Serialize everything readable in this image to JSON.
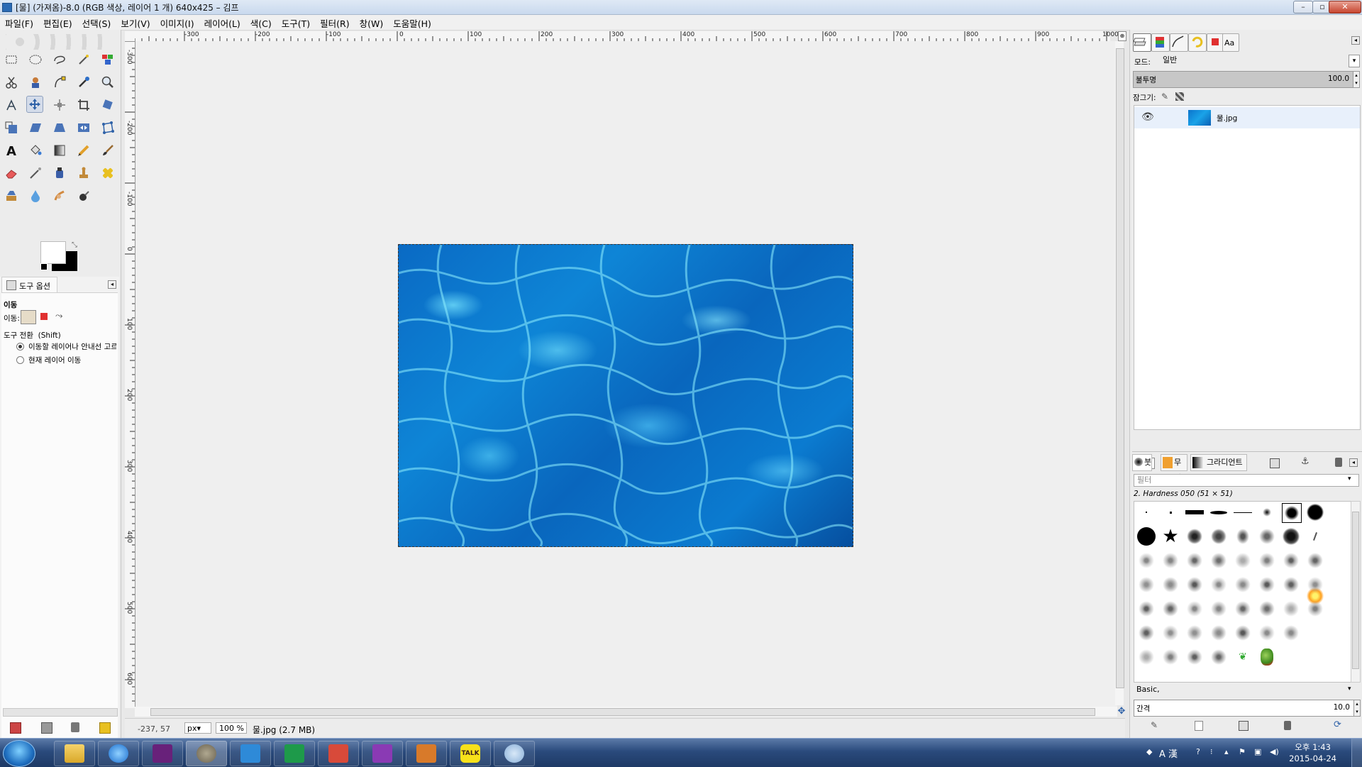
{
  "window": {
    "title": "[물] (가져옴)-8.0 (RGB 색상, 레이어 1 개) 640x425 – 김프",
    "minimize": "–",
    "maximize": "▫",
    "close": "✕"
  },
  "menu": [
    "파일(F)",
    "편집(E)",
    "선택(S)",
    "보기(V)",
    "이미지(I)",
    "레이어(L)",
    "색(C)",
    "도구(T)",
    "필터(R)",
    "창(W)",
    "도움말(H)"
  ],
  "tool_options": {
    "tab_label": "도구 옵션",
    "tool_name": "이동",
    "move_label": "이동:",
    "toggle_label": "도구 전환",
    "toggle_key": "(Shift)",
    "option1": "이동할 레이어나 안내선 고르",
    "option2": "현재 레이어 이동"
  },
  "ruler_top_ticks": [
    "-300",
    "-200",
    "-100",
    "0",
    "100",
    "200",
    "300",
    "400",
    "500",
    "600",
    "700",
    "800",
    "900",
    "1000"
  ],
  "ruler_left_ticks": [
    "-300",
    "-200",
    "-100",
    "0",
    "100",
    "200",
    "300",
    "400",
    "500",
    "600"
  ],
  "statusbar": {
    "coords": "-237, 57",
    "unit": "px▾",
    "zoom": "100 %",
    "info": "물.jpg (2.7 MB)"
  },
  "layers": {
    "mode_label": "모드:",
    "mode_value": "일반",
    "opacity_label": "불투명",
    "opacity_value": "100.0",
    "lock_label": "잠그기:",
    "layer_name": "물.jpg"
  },
  "brushes": {
    "tab1": "붓",
    "tab2": "무늬",
    "tab3": "그라디언트",
    "filter_placeholder": "필터",
    "selected_brush": "2. Hardness 050 (51 × 51)",
    "tag_value": "Basic,",
    "spacing_label": "간격",
    "spacing_value": "10.0"
  },
  "taskbar": {
    "time": "오후 1:43",
    "date": "2015-04-24",
    "ime": "A 漢"
  }
}
